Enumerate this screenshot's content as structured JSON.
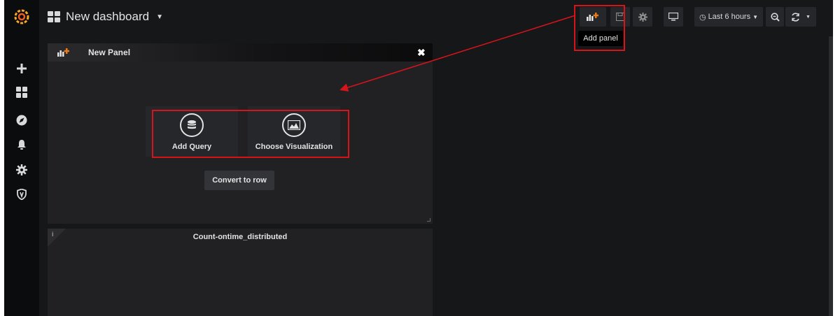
{
  "sidebar": {
    "logo": "grafana-logo",
    "items": [
      {
        "name": "create",
        "icon": "plus-icon"
      },
      {
        "name": "dashboards",
        "icon": "dashboards-grid-icon"
      },
      {
        "name": "explore",
        "icon": "compass-icon"
      },
      {
        "name": "alerting",
        "icon": "bell-icon"
      },
      {
        "name": "configuration",
        "icon": "gear-icon"
      },
      {
        "name": "server-admin",
        "icon": "shield-icon"
      }
    ]
  },
  "header": {
    "dashboard_title": "New dashboard",
    "time_range": "Last 6 hours",
    "add_panel_tooltip": "Add panel"
  },
  "new_panel": {
    "title": "New Panel",
    "add_query": "Add Query",
    "choose_visualization": "Choose Visualization",
    "convert_to_row": "Convert to row"
  },
  "panel2": {
    "info": "i",
    "title": "Count-ontime_distributed"
  },
  "colors": {
    "background": "#161719",
    "sidebar": "#0b0c0e",
    "panel": "#212124",
    "highlight": "#d7141a",
    "accent_orange": "#f5a623",
    "add_panel_plus": "#eb7b18"
  }
}
